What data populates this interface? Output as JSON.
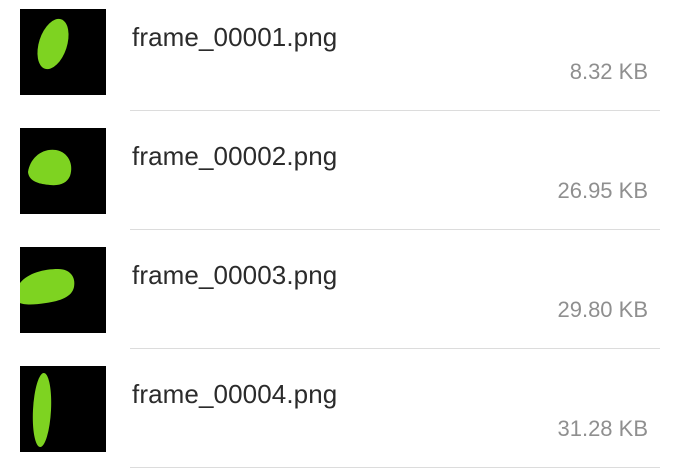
{
  "files": [
    {
      "name": "frame_00001.png",
      "size": "8.32 KB",
      "thumb_icon": "green-blob-image-icon"
    },
    {
      "name": "frame_00002.png",
      "size": "26.95 KB",
      "thumb_icon": "green-blob-image-icon"
    },
    {
      "name": "frame_00003.png",
      "size": "29.80 KB",
      "thumb_icon": "green-blob-image-icon"
    },
    {
      "name": "frame_00004.png",
      "size": "31.28 KB",
      "thumb_icon": "green-blob-image-icon"
    }
  ],
  "colors": {
    "thumb_background": "#000000",
    "blob_fill": "#7ed321",
    "name_text": "#2b2b2b",
    "size_text": "#8f8f8f",
    "divider": "#dcdcdc"
  }
}
